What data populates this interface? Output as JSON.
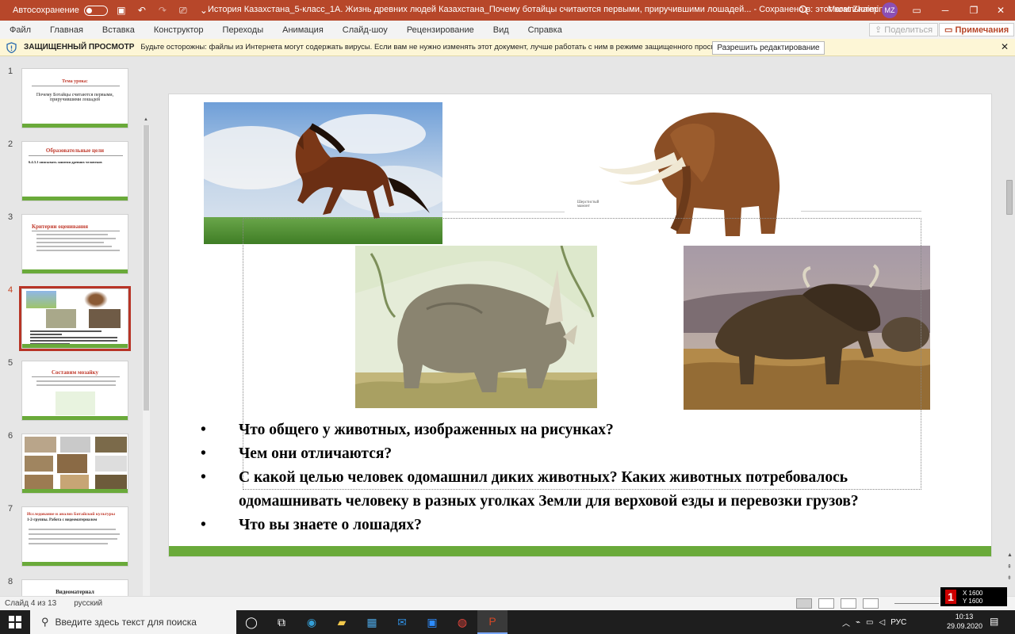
{
  "titlebar": {
    "autosave": "Автосохранение",
    "doc_title": "История Казахстана_5-класс_1А. Жизнь древних людей Казахстана_Почему ботайцы считаются первыми, приручившими лошадей...  -  Сохранено в: этот компьютер",
    "user": "Marat Zhaimin",
    "avatar": "MZ"
  },
  "menu": {
    "items": [
      "Файл",
      "Главная",
      "Вставка",
      "Конструктор",
      "Переходы",
      "Анимация",
      "Слайд-шоу",
      "Рецензирование",
      "Вид",
      "Справка"
    ],
    "share": "Поделиться",
    "comments": "Примечания"
  },
  "protected": {
    "title": "ЗАЩИЩЕННЫЙ ПРОСМОТР",
    "message": "Будьте осторожны: файлы из Интернета могут содержать вирусы. Если вам не нужно изменять этот документ, лучше работать с ним в режиме защищенного просмотра.",
    "button": "Разрешить редактирование"
  },
  "thumbnails": [
    {
      "num": "1",
      "title": "Тема урока:",
      "subtitle": "Почему Ботайцы считаются первыми, приручившими лошадей"
    },
    {
      "num": "2",
      "title": "Образовательные цели",
      "subtitle": "6.4.3.1 описывать занятия древних человеков"
    },
    {
      "num": "3",
      "title": "Критерии оценивания",
      "subtitle": ""
    },
    {
      "num": "4",
      "title": "",
      "subtitle": ""
    },
    {
      "num": "5",
      "title": "Составим мозайку",
      "subtitle": ""
    },
    {
      "num": "6",
      "title": "",
      "subtitle": ""
    },
    {
      "num": "7",
      "title": "Исследование и анализ Ботайской культуры",
      "subtitle": "1-2-группы. Работа с видеоматериалом"
    },
    {
      "num": "8",
      "title": "Видеоматериал",
      "subtitle": ""
    }
  ],
  "slide": {
    "caption_small": "Шерстистый мамонт",
    "bullets": [
      "Что общего у животных, изображенных на рисунках?",
      "Чем они отличаются?",
      "С какой целью человек одомашнил диких животных? Каких животных потребовалось одомашнивать человеку в разных уголках Земли для верховой езды и  перевозки грузов?",
      "Что вы знаете о лошадях?"
    ]
  },
  "status": {
    "slide": "Слайд 4 из 13",
    "lang": "русский"
  },
  "recorder": {
    "num": "1",
    "x": "X 1600",
    "y": "Y 1600"
  },
  "taskbar": {
    "search": "Введите здесь текст для поиска",
    "lang": "РУС",
    "time": "10:13",
    "date": "29.09.2020"
  },
  "colors": {
    "accent": "#b7472a",
    "green": "#6aaa3a",
    "selection": "#b83426"
  }
}
